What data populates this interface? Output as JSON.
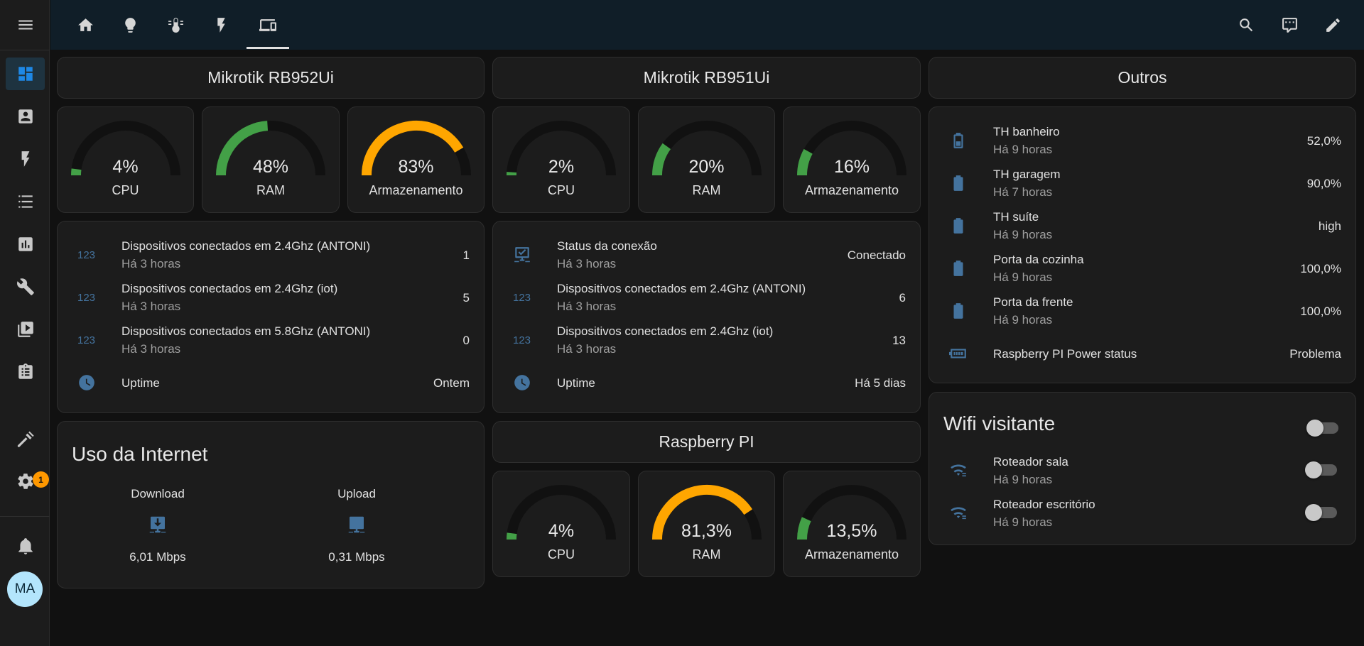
{
  "colors": {
    "accent": "#1e88e5",
    "green": "#43a047",
    "orange": "#ffa600",
    "track": "#2e2e2e",
    "icon_blue": "#44739e",
    "toggle_off": "#5a5a5a"
  },
  "sidebar": {
    "items": [
      {
        "icon": "menu-icon"
      },
      {
        "icon": "dashboard-icon",
        "active": true
      },
      {
        "icon": "account-box-icon"
      },
      {
        "icon": "flash-icon"
      },
      {
        "icon": "list-icon"
      },
      {
        "icon": "chart-box-icon"
      },
      {
        "icon": "wrench-icon"
      },
      {
        "icon": "media-icon"
      },
      {
        "icon": "clipboard-list-icon"
      },
      {
        "icon": "hammer-icon"
      },
      {
        "icon": "cog-icon",
        "badge": "1"
      },
      {
        "icon": "bell-icon"
      }
    ],
    "avatar": "MA"
  },
  "topbar": {
    "tabs": [
      {
        "icon": "home-icon"
      },
      {
        "icon": "lightbulb-icon"
      },
      {
        "icon": "thermometer-icon"
      },
      {
        "icon": "flash-icon"
      },
      {
        "icon": "devices-icon",
        "active": true
      }
    ],
    "actions": [
      {
        "icon": "search-icon"
      },
      {
        "icon": "assist-chat-icon"
      },
      {
        "icon": "pencil-icon"
      }
    ]
  },
  "col1": {
    "title": "Mikrotik RB952Ui",
    "gauges": [
      {
        "value": 4,
        "display": "4%",
        "label": "CPU",
        "color": "#43a047"
      },
      {
        "value": 48,
        "display": "48%",
        "label": "RAM",
        "color": "#43a047"
      },
      {
        "value": 83,
        "display": "83%",
        "label": "Armazenamento",
        "color": "#ffa600"
      }
    ],
    "entities": [
      {
        "icon": "numeric-icon",
        "name": "Dispositivos conectados em 2.4Ghz (ANTONI)",
        "sub": "Há 3 horas",
        "value": "1"
      },
      {
        "icon": "numeric-icon",
        "name": "Dispositivos conectados em 2.4Ghz (iot)",
        "sub": "Há 3 horas",
        "value": "5"
      },
      {
        "icon": "numeric-icon",
        "name": "Dispositivos conectados em 5.8Ghz (ANTONI)",
        "sub": "Há 3 horas",
        "value": "0"
      },
      {
        "icon": "clock-icon",
        "name": "Uptime",
        "sub": "",
        "value": "Ontem"
      }
    ],
    "internet": {
      "title": "Uso da Internet",
      "download": {
        "label": "Download",
        "value": "6,01 Mbps"
      },
      "upload": {
        "label": "Upload",
        "value": "0,31 Mbps"
      }
    }
  },
  "col2": {
    "title": "Mikrotik RB951Ui",
    "gauges": [
      {
        "value": 2,
        "display": "2%",
        "label": "CPU",
        "color": "#43a047"
      },
      {
        "value": 20,
        "display": "20%",
        "label": "RAM",
        "color": "#43a047"
      },
      {
        "value": 16,
        "display": "16%",
        "label": "Armazenamento",
        "color": "#43a047"
      }
    ],
    "entities": [
      {
        "icon": "lan-check-icon",
        "name": "Status da conexão",
        "sub": "Há 3 horas",
        "value": "Conectado"
      },
      {
        "icon": "numeric-icon",
        "name": "Dispositivos conectados em 2.4Ghz (ANTONI)",
        "sub": "Há 3 horas",
        "value": "6"
      },
      {
        "icon": "numeric-icon",
        "name": "Dispositivos conectados em 2.4Ghz (iot)",
        "sub": "Há 3 horas",
        "value": "13"
      },
      {
        "icon": "clock-icon",
        "name": "Uptime",
        "sub": "",
        "value": "Há 5 dias"
      }
    ],
    "pi_title": "Raspberry PI",
    "pi_gauges": [
      {
        "value": 4,
        "display": "4%",
        "label": "CPU",
        "color": "#43a047"
      },
      {
        "value": 81.3,
        "display": "81,3%",
        "label": "RAM",
        "color": "#ffa600"
      },
      {
        "value": 13.5,
        "display": "13,5%",
        "label": "Armazenamento",
        "color": "#43a047"
      }
    ]
  },
  "col3": {
    "title": "Outros",
    "entities": [
      {
        "icon": "battery-low-icon",
        "name": "TH banheiro",
        "sub": "Há 9 horas",
        "value": "52,0%"
      },
      {
        "icon": "battery-icon",
        "name": "TH garagem",
        "sub": "Há 7 horas",
        "value": "90,0%"
      },
      {
        "icon": "battery-icon",
        "name": "TH suíte",
        "sub": "Há 9 horas",
        "value": "high"
      },
      {
        "icon": "battery-icon",
        "name": "Porta da cozinha",
        "sub": "Há 9 horas",
        "value": "100,0%"
      },
      {
        "icon": "battery-icon",
        "name": "Porta da frente",
        "sub": "Há 9 horas",
        "value": "100,0%"
      },
      {
        "icon": "power-status-icon",
        "name": "Raspberry PI Power status",
        "sub": "",
        "value": "Problema"
      }
    ],
    "wifi": {
      "title": "Wifi visitante",
      "master_on": false,
      "items": [
        {
          "icon": "wifi-cog-icon",
          "name": "Roteador sala",
          "sub": "Há 9 horas",
          "on": false
        },
        {
          "icon": "wifi-cog-icon",
          "name": "Roteador escritório",
          "sub": "Há 9 horas",
          "on": false
        }
      ]
    }
  }
}
